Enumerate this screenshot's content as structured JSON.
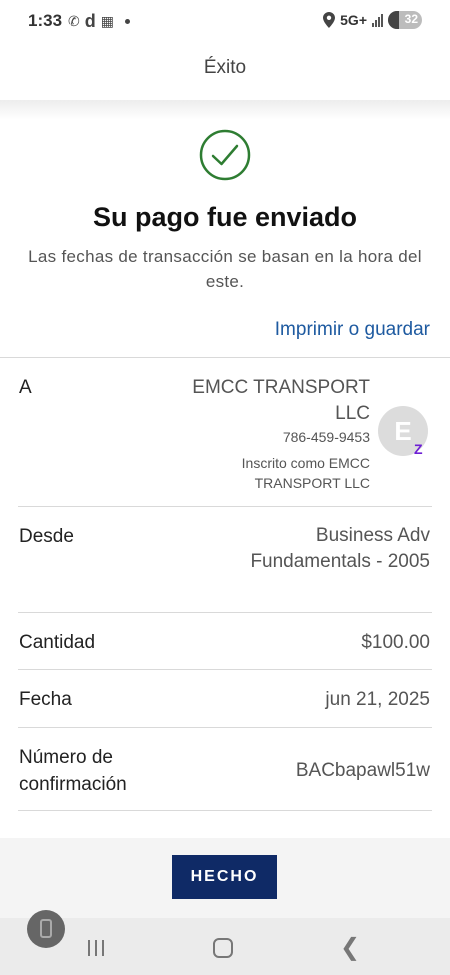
{
  "status_bar": {
    "time": "1:33",
    "network": "5G+",
    "battery": "32",
    "battery_level": 0.32,
    "icons": [
      "whatsapp-icon",
      "d-app-icon",
      "gallery-icon",
      "notification-dot-icon",
      "location-icon",
      "signal-icon",
      "battery-icon"
    ]
  },
  "header": {
    "title": "Éxito"
  },
  "success": {
    "headline": "Su pago fue enviado",
    "subtext": "Las fechas de transacción se basan en la hora del este.",
    "print_link": "Imprimir o guardar",
    "check_color": "#2e7d32"
  },
  "details": {
    "to": {
      "label": "A",
      "name": "EMCC TRANSPORT LLC",
      "phone": "786-459-9453",
      "enrolled": "Inscrito como EMCC TRANSPORT LLC",
      "avatar_initial": "E",
      "badge": "Z"
    },
    "from": {
      "label": "Desde",
      "value": "Business Adv Fundamentals - 2005"
    },
    "amount": {
      "label": "Cantidad",
      "value": "$100.00"
    },
    "date": {
      "label": "Fecha",
      "value": "jun 21, 2025"
    },
    "confirmation": {
      "label": "Número de confirmación",
      "value": "BACbapawl51w"
    }
  },
  "actions": {
    "done": "HECHO"
  },
  "colors": {
    "link": "#1e5aa0",
    "button": "#0f2a66",
    "zelle": "#6d1ed4"
  }
}
